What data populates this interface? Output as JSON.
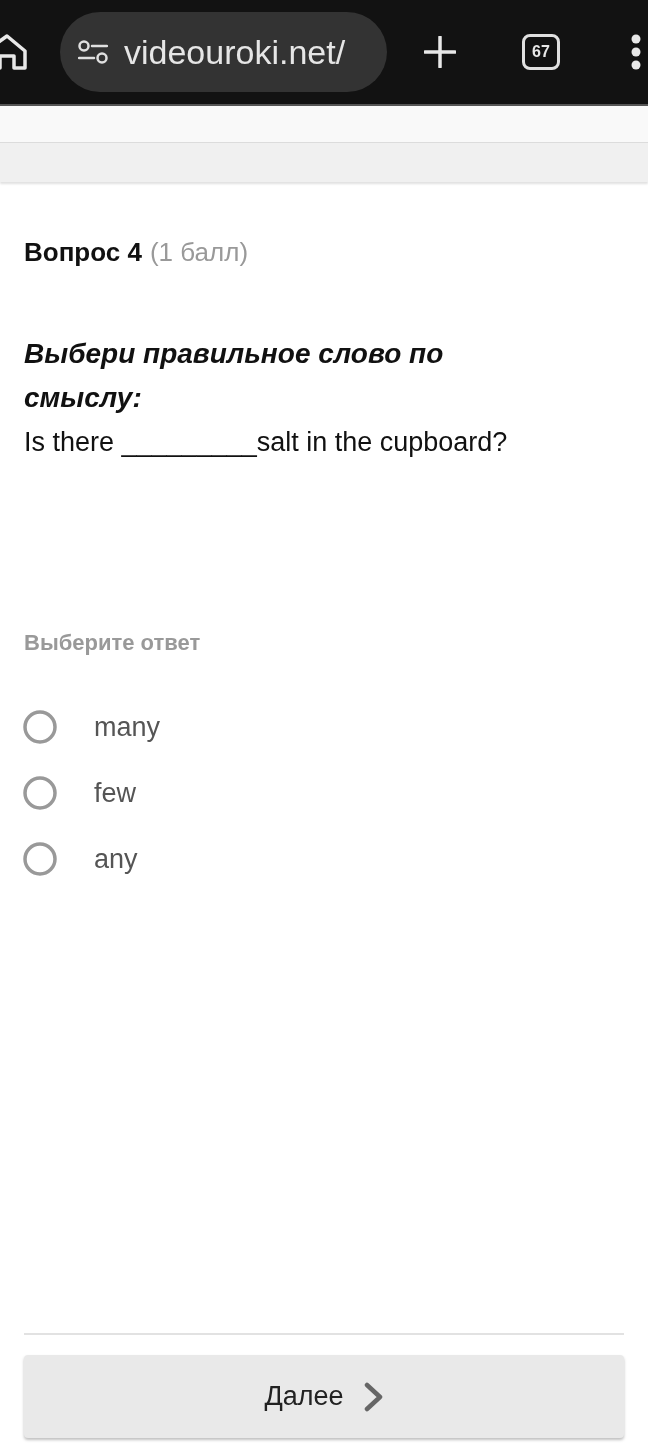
{
  "browser": {
    "url": "videouroki.net/",
    "tab_count": "67"
  },
  "question": {
    "number": "Вопрос 4",
    "points": "(1 балл)",
    "instruction": "Выбери правильное слово по смыслу:",
    "text": "Is there _________salt in the cupboard?"
  },
  "answers": {
    "label": "Выберите ответ",
    "options": [
      {
        "text": "many",
        "selected": false
      },
      {
        "text": "few",
        "selected": false
      },
      {
        "text": "any",
        "selected": false
      }
    ]
  },
  "next_button": {
    "label": "Далее"
  }
}
